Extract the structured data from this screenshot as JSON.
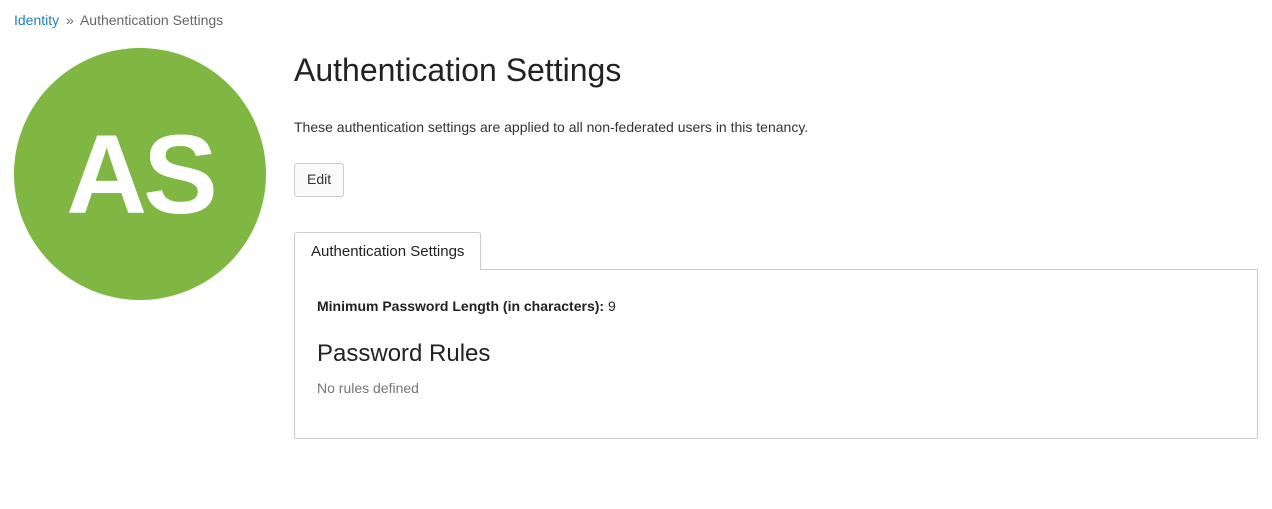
{
  "breadcrumb": {
    "parent": "Identity",
    "separator": "»",
    "current": "Authentication Settings"
  },
  "avatar": {
    "initials": "AS"
  },
  "header": {
    "title": "Authentication Settings",
    "description": "These authentication settings are applied to all non-federated users in this tenancy."
  },
  "actions": {
    "edit_label": "Edit"
  },
  "tabs": {
    "auth_settings_label": "Authentication Settings"
  },
  "details": {
    "min_password_length_label": "Minimum Password Length (in characters):",
    "min_password_length_value": "9",
    "password_rules_heading": "Password Rules",
    "password_rules_empty": "No rules defined"
  }
}
